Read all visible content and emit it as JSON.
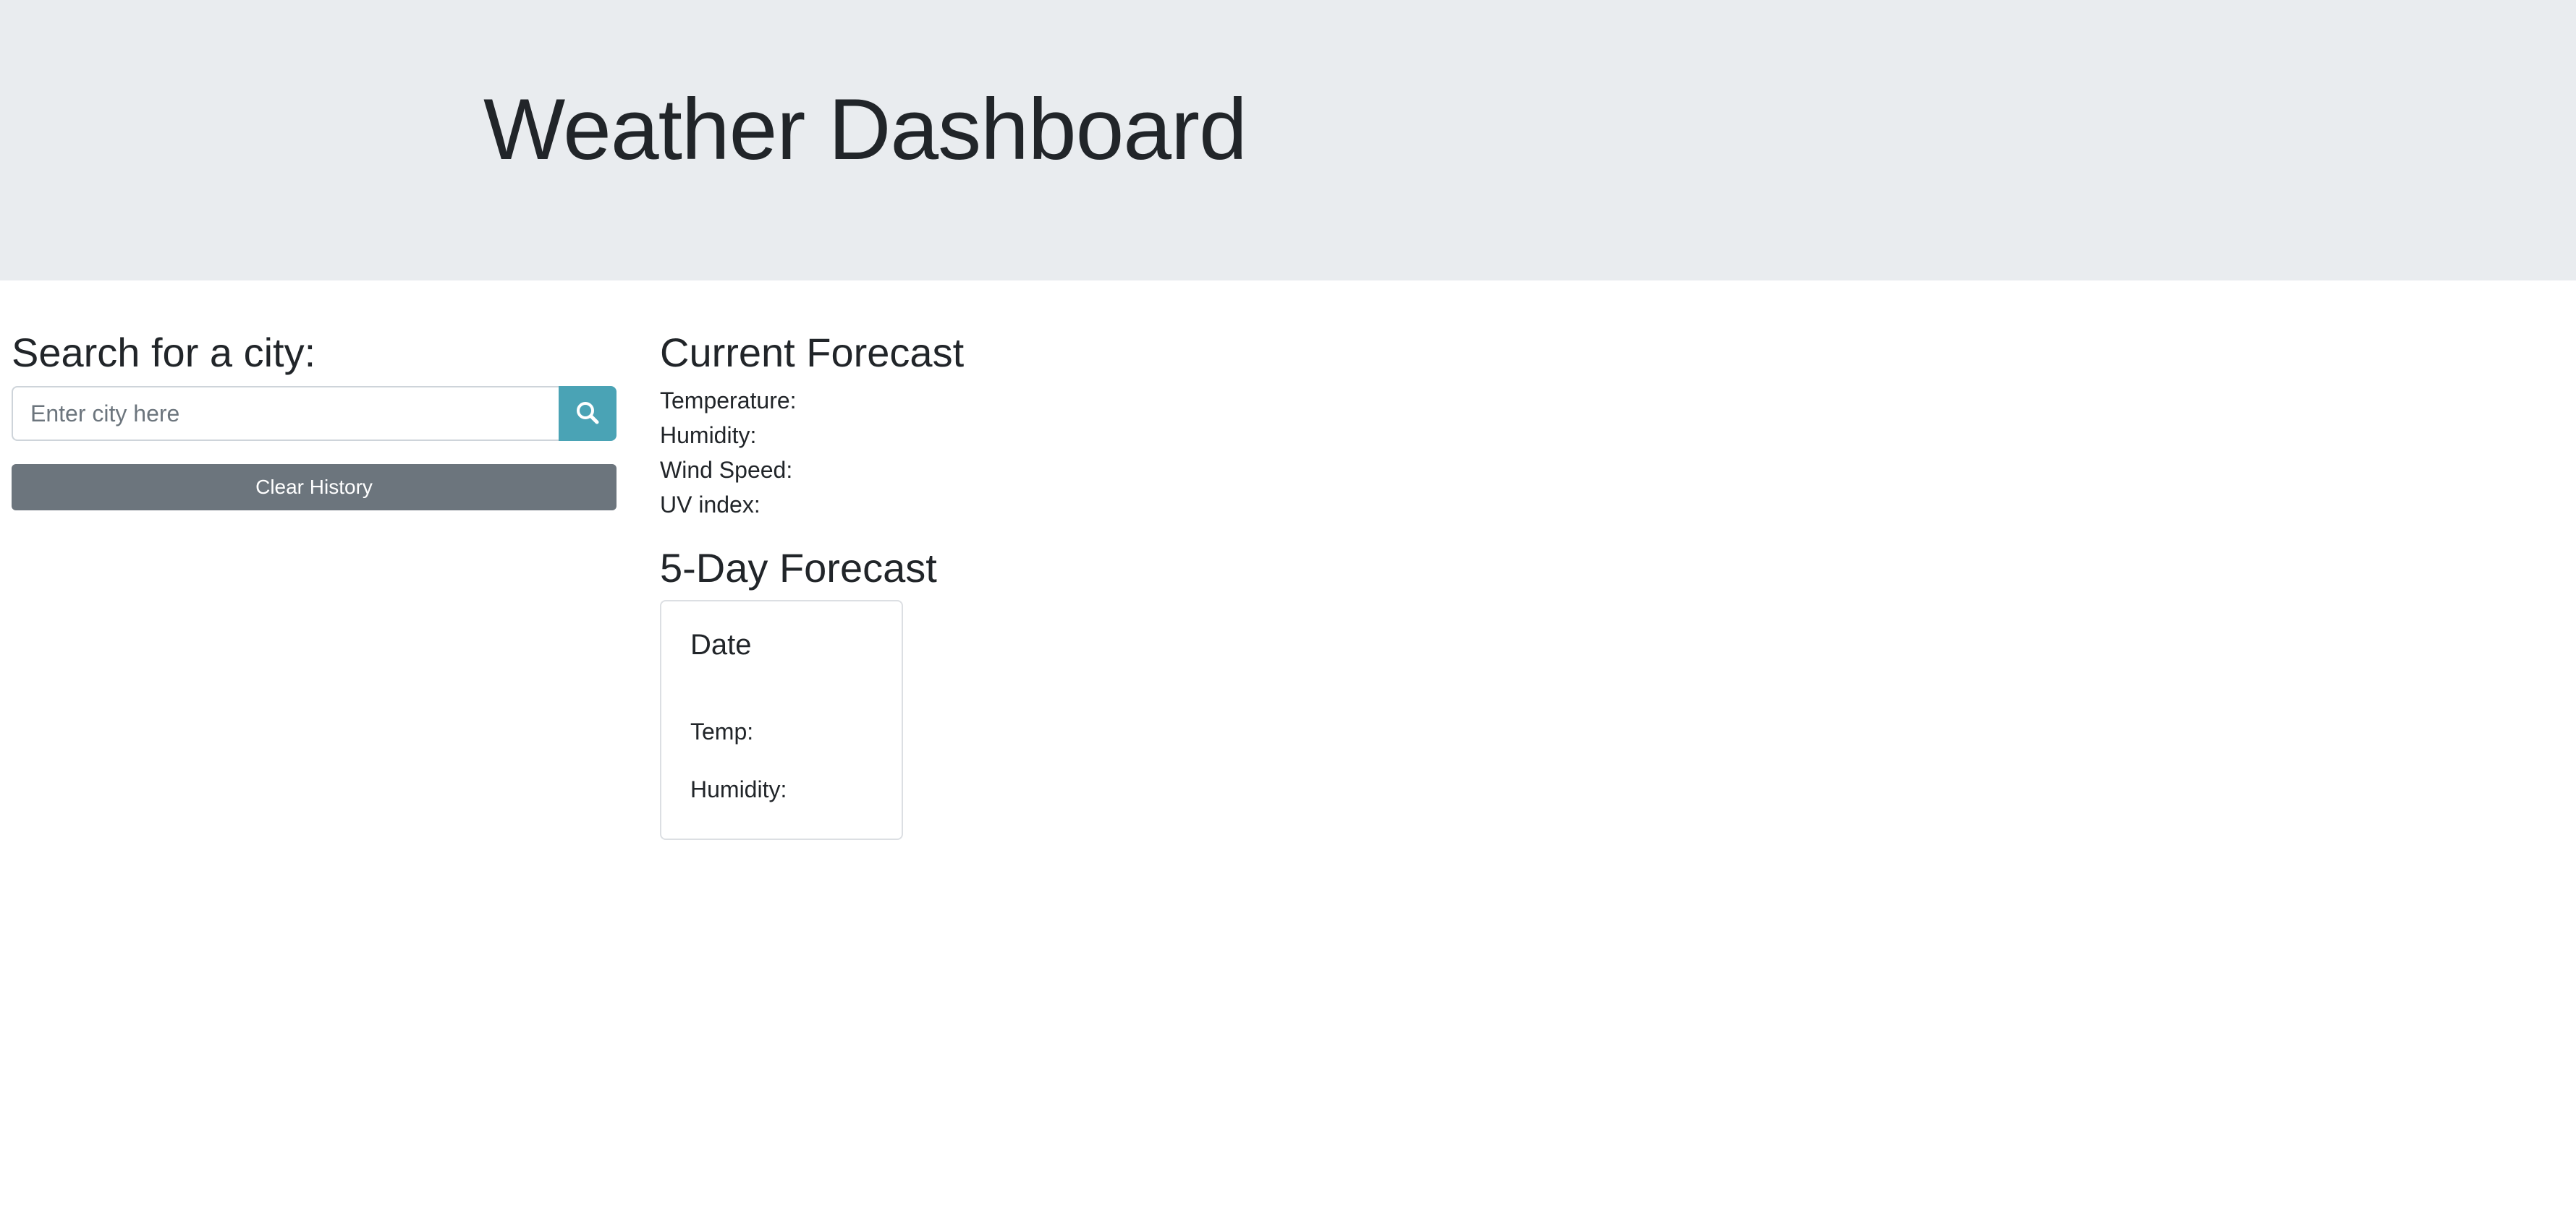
{
  "header": {
    "title": "Weather Dashboard"
  },
  "search": {
    "heading": "Search for a city:",
    "placeholder": "Enter city here",
    "search_button_icon": "search-icon",
    "clear_label": "Clear History"
  },
  "current": {
    "heading": "Current Forecast",
    "temperature_label": "Temperature:",
    "humidity_label": "Humidity:",
    "wind_label": "Wind Speed:",
    "uv_label": "UV index:"
  },
  "five_day": {
    "heading": "5-Day Forecast",
    "cards": [
      {
        "date": "Date",
        "temp_label": "Temp:",
        "humidity_label": "Humidity:"
      }
    ]
  },
  "colors": {
    "header_bg": "#e9ecef",
    "search_button": "#4aa3b5",
    "clear_button": "#6c757d",
    "text": "#212529"
  }
}
